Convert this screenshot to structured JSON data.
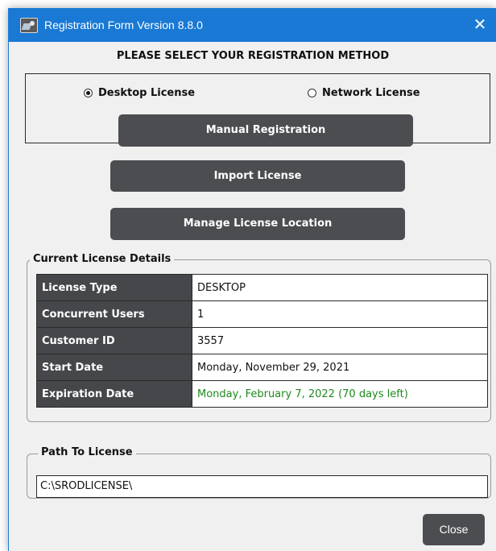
{
  "window": {
    "title": "Registration Form Version 8.8.0",
    "close_glyph": "✕",
    "app_icon": "app-icon"
  },
  "heading": "PLEASE SELECT YOUR REGISTRATION METHOD",
  "registration_method": {
    "options": [
      {
        "label": "Desktop License",
        "selected": true
      },
      {
        "label": "Network License",
        "selected": false
      }
    ]
  },
  "buttons": {
    "manual_registration": "Manual Registration",
    "import_license": "Import License",
    "manage_license_location": "Manage License Location",
    "close": "Close"
  },
  "current_license": {
    "legend": "Current License Details",
    "rows": [
      {
        "label": "License Type",
        "value": "DESKTOP"
      },
      {
        "label": "Concurrent Users",
        "value": "1"
      },
      {
        "label": "Customer ID",
        "value": "3557"
      },
      {
        "label": "Start Date",
        "value": "Monday, November 29, 2021"
      },
      {
        "label": "Expiration Date",
        "value": "Monday, February 7, 2022 (70 days left)"
      }
    ]
  },
  "path_to_license": {
    "legend": "Path To License",
    "value": "C:\\SRODLICENSE\\"
  },
  "colors": {
    "titlebar": "#1979d4",
    "button_bg": "#4b4d50",
    "label_cell_bg": "#45474a",
    "expiration_text": "#1d8a1d"
  }
}
